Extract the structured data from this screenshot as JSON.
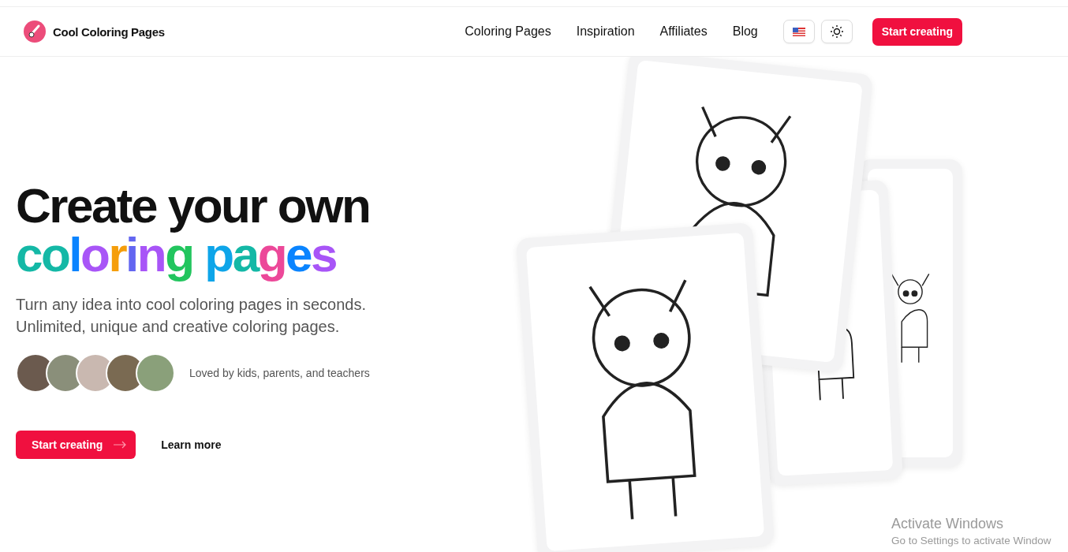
{
  "brand": {
    "name": "Cool Coloring Pages"
  },
  "nav": {
    "links": [
      {
        "label": "Coloring Pages"
      },
      {
        "label": "Inspiration"
      },
      {
        "label": "Affiliates"
      },
      {
        "label": "Blog"
      }
    ],
    "cta": "Start creating"
  },
  "hero": {
    "headline": "Create your own",
    "headline_colored": [
      {
        "text": "co",
        "color": "#14b8a6"
      },
      {
        "text": "l",
        "color": "#0a84ff"
      },
      {
        "text": "o",
        "color": "#a855f7"
      },
      {
        "text": "r",
        "color": "#f59e0b"
      },
      {
        "text": "i",
        "color": "#6366f1"
      },
      {
        "text": "n",
        "color": "#a855f7"
      },
      {
        "text": "g",
        "color": "#22c55e"
      },
      {
        "text": " p",
        "color": "#0ea5e9"
      },
      {
        "text": "a",
        "color": "#14b8a6"
      },
      {
        "text": "g",
        "color": "#ec4899"
      },
      {
        "text": "e",
        "color": "#0a84ff"
      },
      {
        "text": "s",
        "color": "#a855f7"
      }
    ],
    "subtitle": [
      "Turn any idea into cool coloring pages in seconds.",
      "Unlimited, unique and creative coloring pages."
    ],
    "social_proof": {
      "avatars": [
        {
          "kind": "photo"
        },
        {
          "kind": "photo"
        },
        {
          "kind": "photo"
        },
        {
          "kind": "photo"
        },
        {
          "kind": "photo"
        }
      ],
      "text": "Loved by kids, parents, and teachers"
    },
    "primary_button": "Start creating",
    "secondary_link": "Learn more"
  },
  "system_overlay": {
    "title": "Activate Windows",
    "subtitle": "Go to Settings to activate Window"
  }
}
